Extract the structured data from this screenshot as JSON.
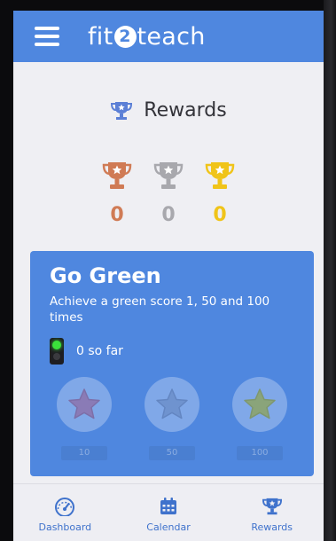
{
  "app": {
    "brand_prefix": "fit",
    "brand_number": "2",
    "brand_suffix": "teach"
  },
  "rewards": {
    "title": "Rewards",
    "trophies": [
      {
        "name": "bronze",
        "count": "0",
        "color": "#d07b55"
      },
      {
        "name": "silver",
        "count": "0",
        "color": "#a8a8ad"
      },
      {
        "name": "gold",
        "count": "0",
        "color": "#f0c419"
      }
    ]
  },
  "card": {
    "title": "Go Green",
    "description": "Achieve a green score 1, 50 and 100 times",
    "progress_text": "0 so far",
    "background": "#4f87df",
    "milestones": [
      {
        "label": "10",
        "star_color": "#8a7bb6"
      },
      {
        "label": "50",
        "star_color": "#6f93cf"
      },
      {
        "label": "100",
        "star_color": "#8aa47a"
      }
    ]
  },
  "nav": {
    "items": [
      {
        "label": "Dashboard",
        "icon": "gauge-icon"
      },
      {
        "label": "Calendar",
        "icon": "calendar-icon"
      },
      {
        "label": "Rewards",
        "icon": "trophy-icon"
      }
    ],
    "accent": "#3f72cc"
  }
}
